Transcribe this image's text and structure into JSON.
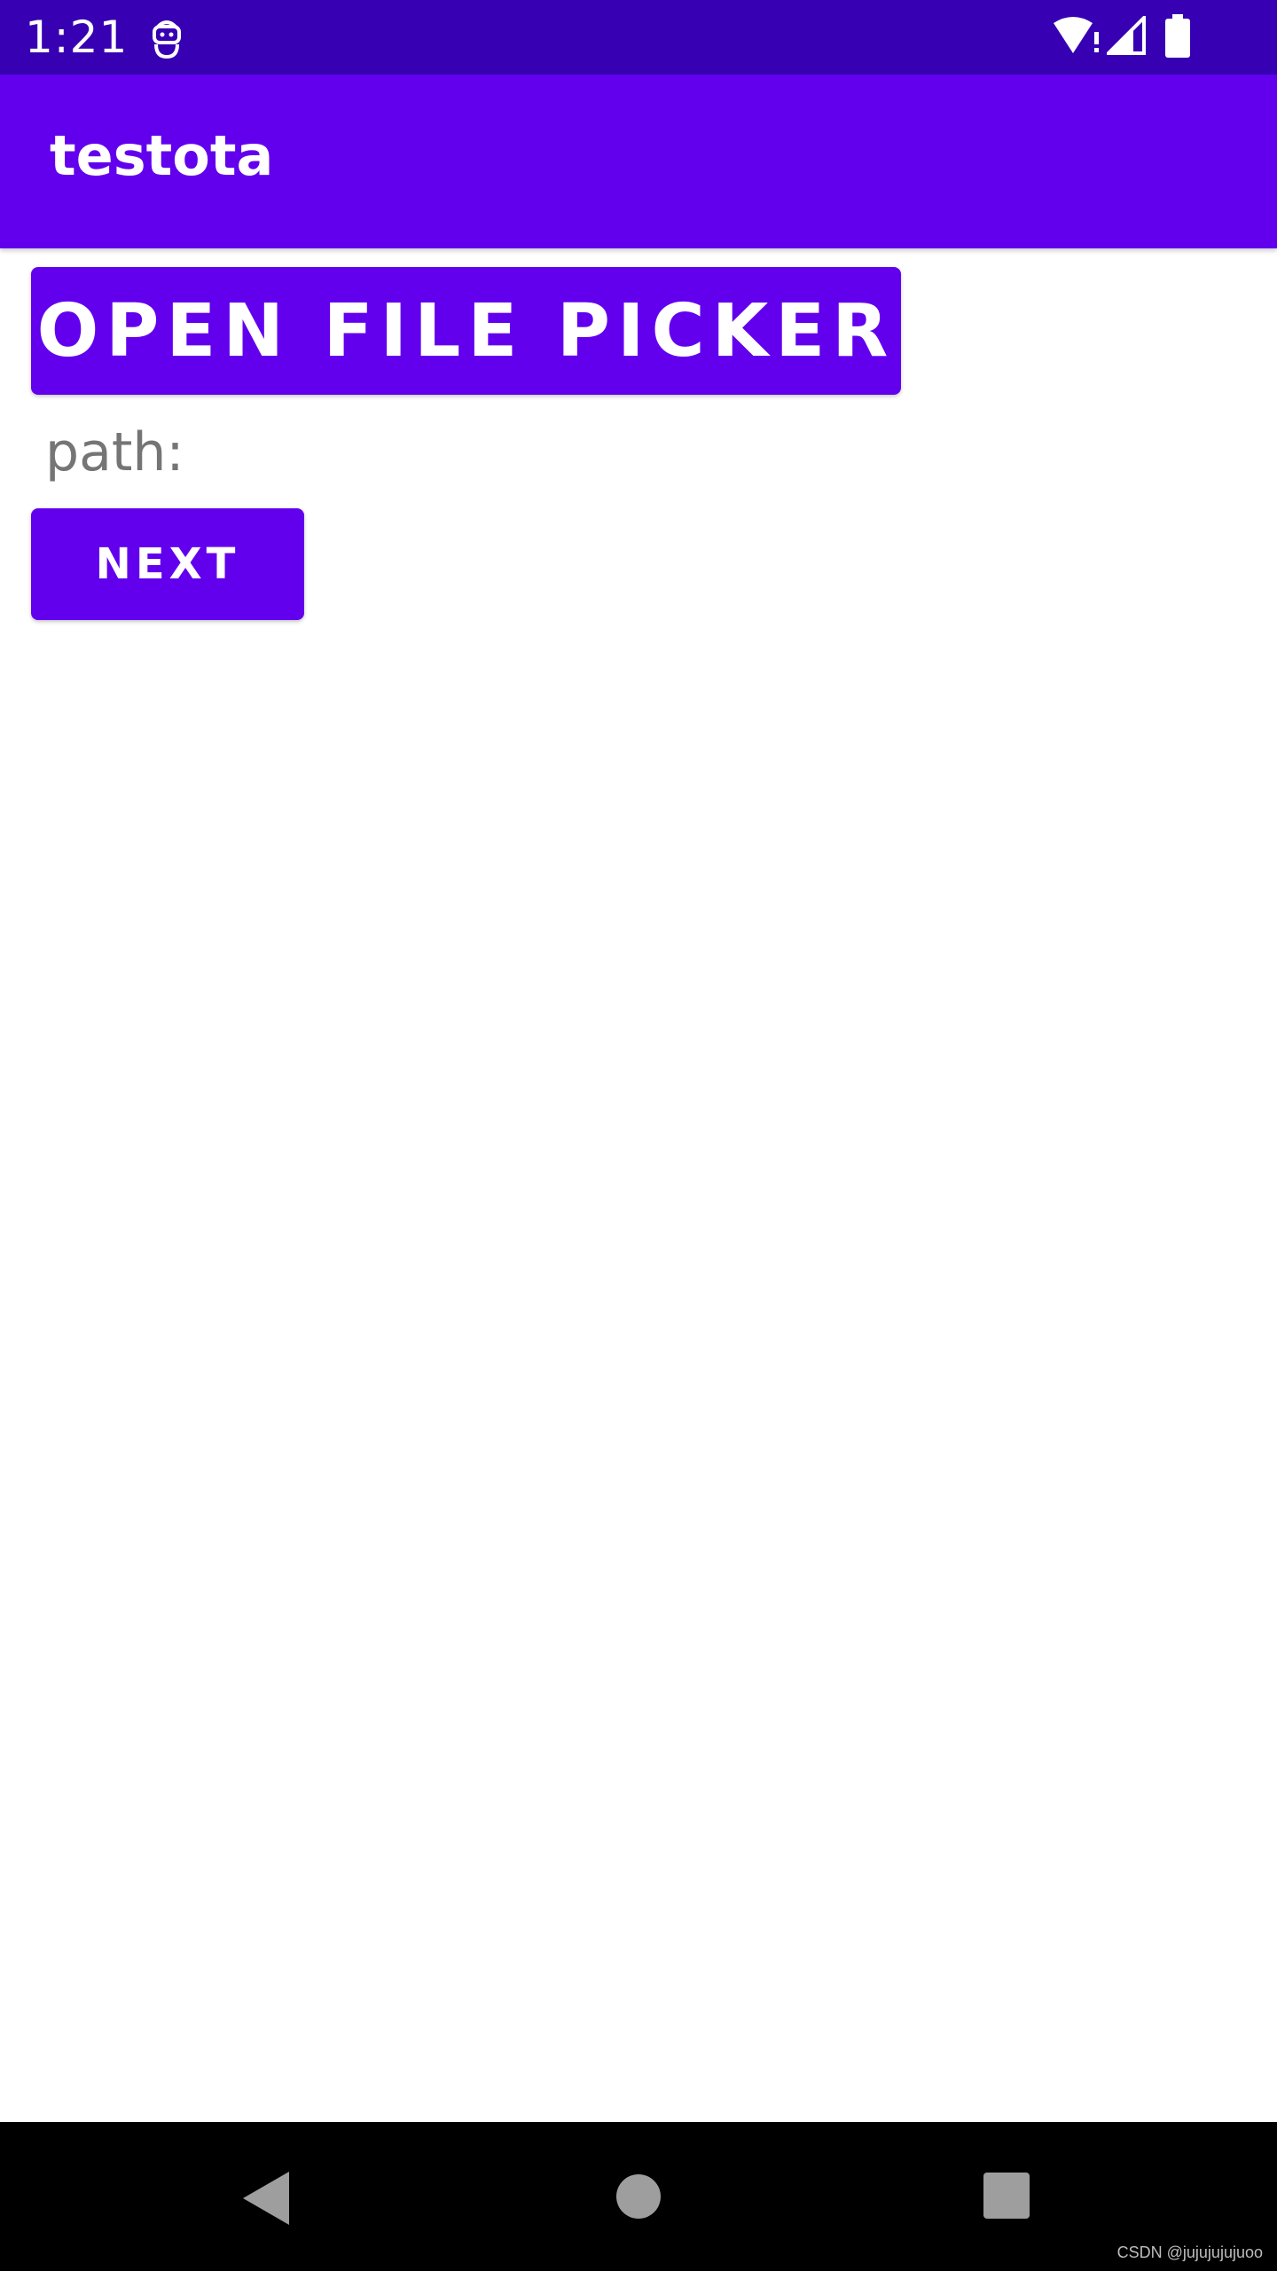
{
  "status_bar": {
    "time": "1:21",
    "icons": [
      "notification-android-icon",
      "wifi-alert-icon",
      "cell-signal-icon",
      "battery-icon"
    ]
  },
  "app_bar": {
    "title": "testota"
  },
  "main": {
    "open_file_picker_label": "OPEN FILE PICKER",
    "path_label": "path:",
    "next_label": "NEXT"
  },
  "nav_bar": {
    "icons": [
      "back-icon",
      "home-icon",
      "recents-icon"
    ]
  },
  "watermark": "CSDN @jujujujujuoo",
  "colors": {
    "status_bar": "#3700B3",
    "primary": "#6200EE",
    "button_text": "#FFFFFF",
    "path_text": "#757575",
    "nav_bar": "#000000",
    "nav_icon": "#9E9E9E"
  }
}
